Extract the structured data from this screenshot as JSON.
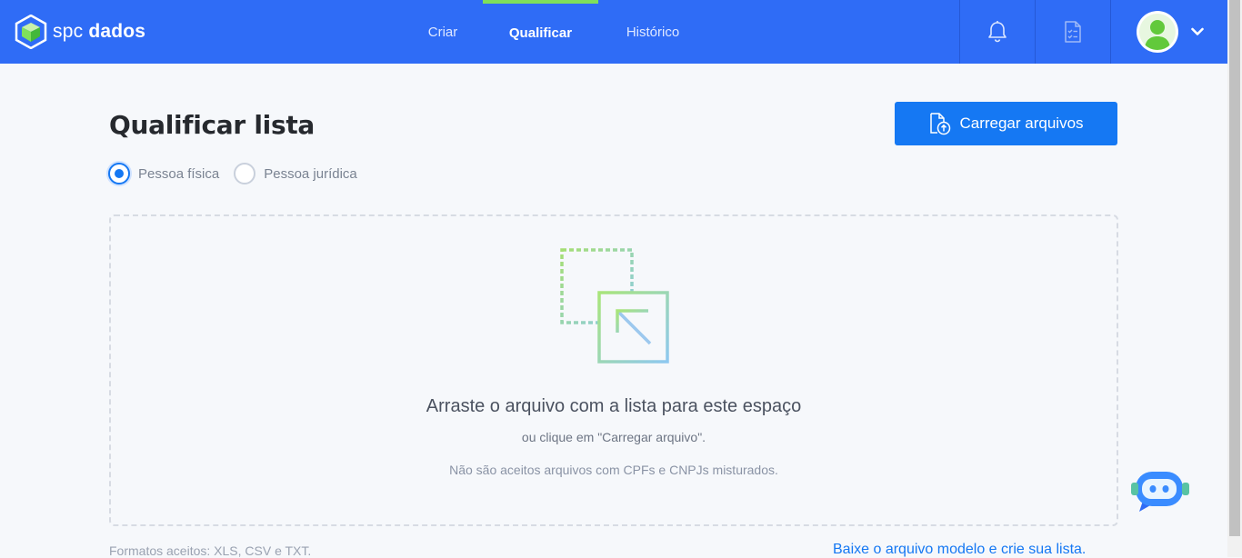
{
  "brand": {
    "name_light": "spc",
    "name_bold": "dados",
    "accent": "#2f6cf6",
    "highlight": "#7fe05a"
  },
  "nav": {
    "tabs": [
      {
        "label": "Criar"
      },
      {
        "label": "Qualificar",
        "active": true
      },
      {
        "label": "Histórico"
      }
    ]
  },
  "toolbar": {
    "icons": [
      "bell-icon",
      "checklist-icon",
      "avatar",
      "chevron-down-icon"
    ]
  },
  "page": {
    "title": "Qualificar lista",
    "upload_button": "Carregar arquivos",
    "person_type": {
      "options": [
        {
          "label": "Pessoa física",
          "checked": true
        },
        {
          "label": "Pessoa jurídica",
          "checked": false
        }
      ]
    },
    "dropzone": {
      "main": "Arraste o arquivo com a lista para este espaço",
      "sub": "ou clique em \"Carregar arquivo\".",
      "warning": "Não são aceitos arquivos com CPFs e CNPJs misturados."
    },
    "formats": "Formatos aceitos: XLS, CSV e TXT.",
    "model_link": "Baixe o arquivo modelo e crie sua lista."
  }
}
